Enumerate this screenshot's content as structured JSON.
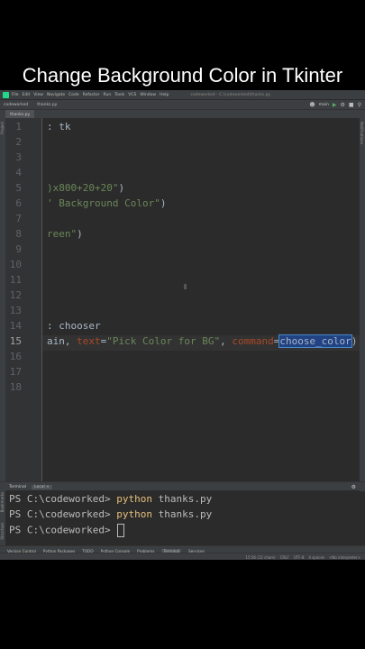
{
  "banner": {
    "title": "Change Background Color in Tkinter"
  },
  "menubar": {
    "items": [
      "File",
      "Edit",
      "View",
      "Navigate",
      "Code",
      "Refactor",
      "Run",
      "Tools",
      "VCS",
      "Window",
      "Help"
    ],
    "project_path": "codeworked - C:\\codeworked\\thanks.py"
  },
  "navbar": {
    "project": "codeworked",
    "file": "thanks.py",
    "branch": "main"
  },
  "tabs": {
    "active": "thanks.py"
  },
  "sidebars": {
    "project": "Project",
    "notifications": "Notifications",
    "structure": "Structure",
    "bookmarks": "Bookmarks"
  },
  "editor": {
    "active_line": 15,
    "lines": [
      {
        "n": "1",
        "t1": ": tk",
        "t2": "",
        "t3": "",
        "t4": "",
        "t5": ""
      },
      {
        "n": "2"
      },
      {
        "n": "3"
      },
      {
        "n": "4"
      },
      {
        "n": "5",
        "t1": "",
        "s1": ")x800+20+20\"",
        "t2": ")"
      },
      {
        "n": "6",
        "t1": "",
        "s1": "' Background Color\"",
        "t2": ")"
      },
      {
        "n": "7"
      },
      {
        "n": "8",
        "t1": "",
        "s1": "reen\"",
        "t2": ")"
      },
      {
        "n": "9"
      },
      {
        "n": "10"
      },
      {
        "n": "11"
      },
      {
        "n": "12"
      },
      {
        "n": "13"
      },
      {
        "n": "14",
        "t1": ": chooser"
      },
      {
        "n": "15",
        "t1": "ain, ",
        "p1": "text",
        "eq1": "=",
        "s1": "\"Pick Color for BG\"",
        "c1": ", ",
        "p2": "command",
        "eq2": "=",
        "sel": "choose_color",
        "t2": ")"
      },
      {
        "n": "16"
      },
      {
        "n": "17"
      },
      {
        "n": "18"
      }
    ]
  },
  "terminal": {
    "header": "Terminal",
    "tab": "Local",
    "prompt": "PS C:\\codeworked> ",
    "lines": [
      {
        "cmd": "python",
        "arg": " thanks.py"
      },
      {
        "cmd": "python",
        "arg": " thanks.py"
      }
    ]
  },
  "toolwindows": [
    "Version Control",
    "Python Packages",
    "TODO",
    "Python Console",
    "Problems",
    "Terminal",
    "Services"
  ],
  "statusbar": {
    "position": "15:56 (12 chars)",
    "line_sep": "CRLF",
    "encoding": "UTF-8",
    "indent": "4 spaces",
    "interpreter": "<No interpreter>"
  },
  "colors": {
    "editor_bg": "#2b2b2b",
    "string": "#6a8759",
    "param": "#aa4926",
    "selection": "#214283",
    "terminal_cmd": "#e5c07b"
  }
}
